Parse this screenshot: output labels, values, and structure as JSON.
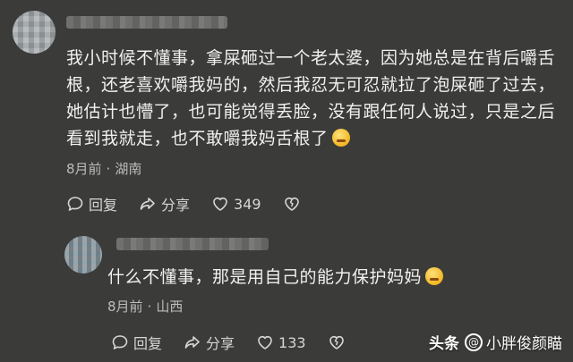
{
  "comments": [
    {
      "text": "我小时候不懂事，拿屎砸过一个老太婆，因为她总是在背后嚼舌根，还老喜欢嚼我妈的，然后我忍无可忍就拉了泡屎砸了过去，她估计也懵了，也可能觉得丢脸，没有跟任何人说过，只是之后看到我就走，也不敢嚼我妈舌根了",
      "emoji": "sweat-smile-emoji",
      "time": "8月前",
      "separator": "·",
      "location": "湖南",
      "reply_label": "回复",
      "share_label": "分享",
      "like_count": "349"
    },
    {
      "text": "什么不懂事，那是用自己的能力保护妈妈",
      "emoji": "smirk-emoji",
      "time": "8月前",
      "separator": "·",
      "location": "山西",
      "reply_label": "回复",
      "share_label": "分享",
      "like_count": "133"
    }
  ],
  "watermark": {
    "logo": "头条",
    "handle": "小胖俊颜瞄"
  },
  "colors": {
    "background": "#3b3b3a",
    "text": "#f0f0f0",
    "meta": "#bdbdbd"
  }
}
